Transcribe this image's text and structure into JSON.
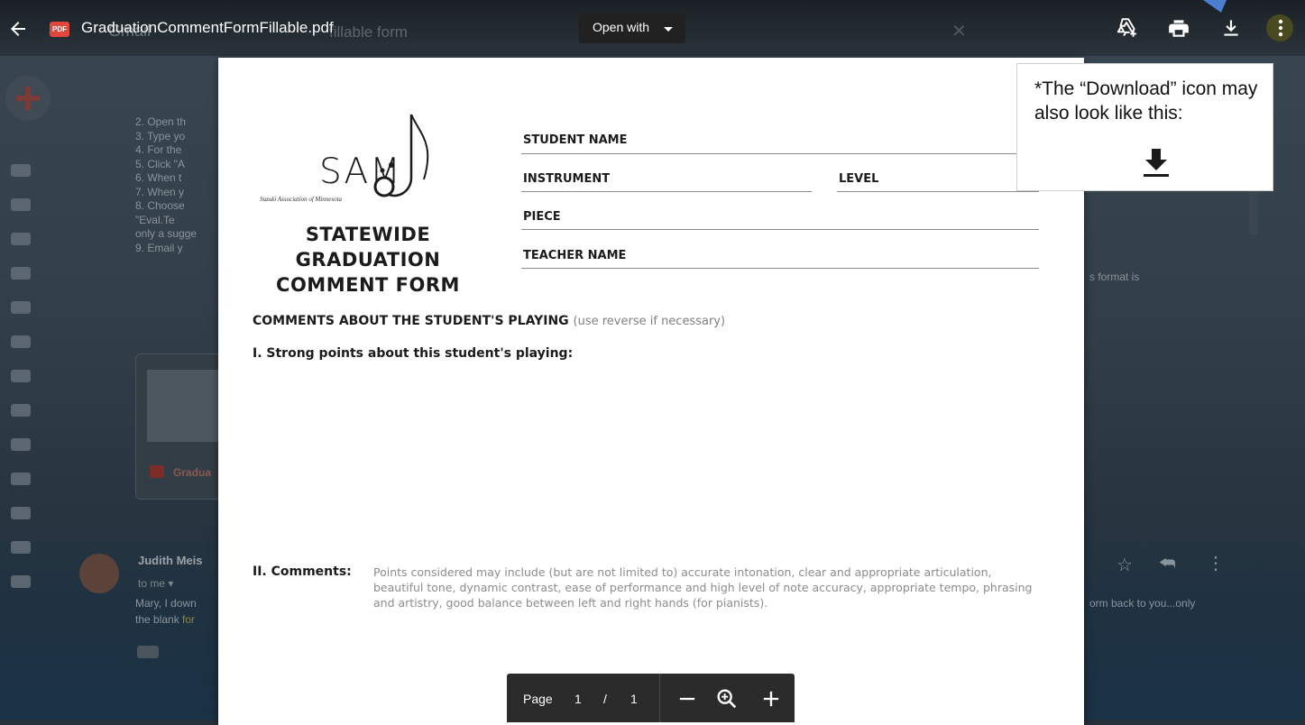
{
  "viewer": {
    "file_name": "GraduationCommentFormFillable.pdf",
    "pdf_badge": "PDF",
    "open_with": "Open with",
    "ghost_app": "Gmail",
    "ghost_search": "fillable form"
  },
  "background": {
    "list_items": [
      "2.   Open th",
      "3.   Type yo",
      "4.   For the",
      "5.   Click \"A",
      "6.   When t",
      "7.   When y",
      "8.   Choose",
      "     \"Eval.Te",
      "only a sugge",
      "9.   Email y"
    ],
    "right_snippet": "s format is",
    "card_label": "Gradua",
    "sender": "Judith Meis",
    "to_me": "to me",
    "body_line1": "Mary, I down",
    "body_line2_a": "the blank ",
    "body_line2_b": "for",
    "right_body": "orm back to you...only"
  },
  "form": {
    "logo_text": "SAM",
    "logo_subtitle": "Suzuki Association of Minnesota",
    "title_line1": "STATEWIDE GRADUATION",
    "title_line2": "COMMENT FORM",
    "fields": {
      "student_name": "STUDENT NAME",
      "instrument": "INSTRUMENT",
      "level": "LEVEL",
      "piece": "PIECE",
      "teacher_name": "TEACHER NAME"
    },
    "comments_heading": "COMMENTS ABOUT THE STUDENT'S PLAYING",
    "comments_note": "(use reverse if necessary)",
    "strong_points": "I. Strong points about this student's playing:",
    "comments_label": "II. Comments:",
    "comments_text": "Points considered may include (but are not limited to) accurate intonation, clear and appropriate articulation, beautiful tone, dynamic contrast, ease of performance and high level of note accuracy, appropriate tempo, phrasing and artistry, good balance between left and right hands (for pianists)."
  },
  "callout": {
    "text": "*The “Download” icon may also look like this:"
  },
  "pager": {
    "label": "Page",
    "current": "1",
    "separator": "/",
    "total": "1"
  },
  "icons": [
    "back-icon",
    "add-to-drive-icon",
    "print-icon",
    "download-icon",
    "more-vert-icon",
    "zoom-out-icon",
    "zoom-icon",
    "zoom-in-icon",
    "download-alt-icon"
  ]
}
